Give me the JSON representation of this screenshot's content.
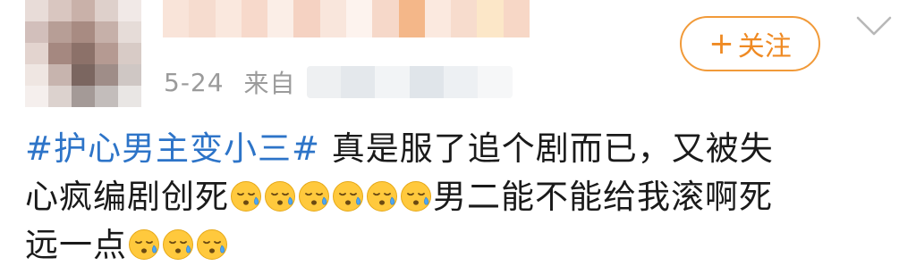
{
  "post": {
    "date": "5-24",
    "from_label": "来自",
    "hashtag": "#护心男主变小三#",
    "line1_rest": "真是服了追个剧而已，又被失",
    "line2_start": "心疯编剧创死",
    "line2_end": "男二能不能给我滚啊死",
    "line3_start": "远一点",
    "emoji_name": "sweat-face-emoji",
    "emoji_count_line2": 6,
    "emoji_count_line3": 3
  },
  "follow": {
    "plus": "+",
    "label": "关注",
    "color": "#ef8a23"
  },
  "icons": {
    "more": "chevron-down-icon"
  },
  "colors": {
    "hashtag": "#2d74c8",
    "meta": "#9b9b9b",
    "text": "#1a1a1a"
  }
}
